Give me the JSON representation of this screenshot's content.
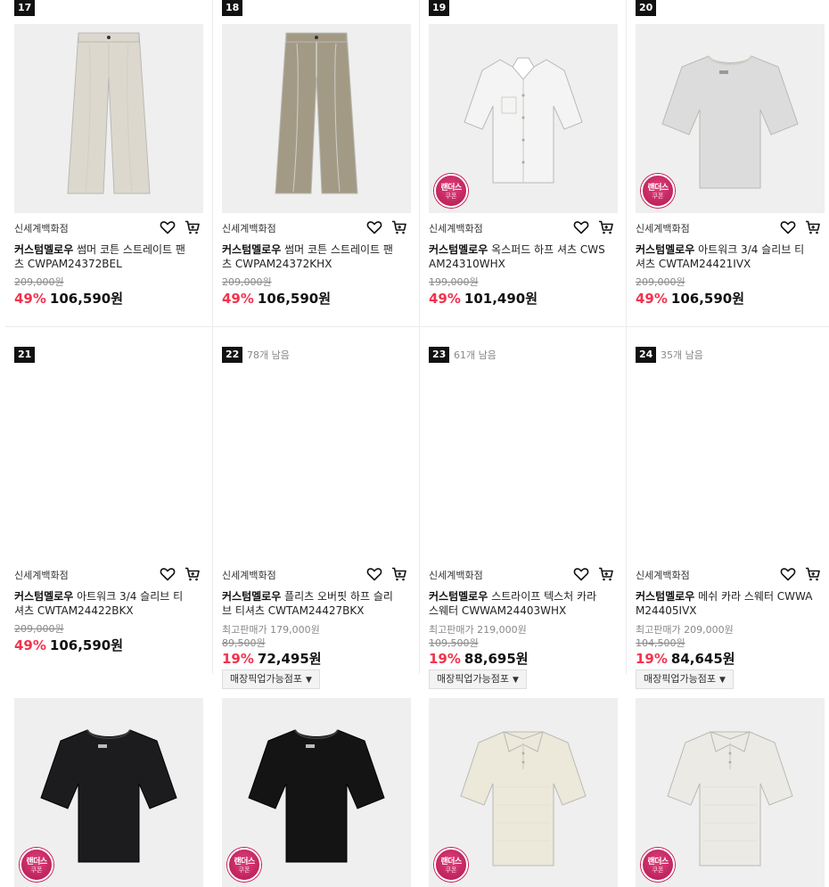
{
  "colors": {
    "discount": "#f2334d",
    "rank_bg": "#111111",
    "coupon": "#c9184f"
  },
  "products": [
    {
      "rank": "17",
      "stock": "",
      "store": "신세계백화점",
      "brand": "커스텀멜로우",
      "name": "썸머 코튼 스트레이트 팬츠 CWPAM24372BEL",
      "max_price": "",
      "original": "209,000원",
      "discount": "49%",
      "price": "106,590원",
      "pickup": "",
      "coupon": false,
      "icon": "pants-icon",
      "garment": "pants",
      "color": "#dcd8ce"
    },
    {
      "rank": "18",
      "stock": "",
      "store": "신세계백화점",
      "brand": "커스텀멜로우",
      "name": "썸머 코튼 스트레이트 팬츠 CWPAM24372KHX",
      "max_price": "",
      "original": "209,000원",
      "discount": "49%",
      "price": "106,590원",
      "pickup": "",
      "coupon": false,
      "icon": "pants-icon",
      "garment": "pants",
      "color": "#a39a85"
    },
    {
      "rank": "19",
      "stock": "",
      "store": "신세계백화점",
      "brand": "커스텀멜로우",
      "name": "옥스퍼드 하프 셔츠 CWSAM24310WHX",
      "max_price": "",
      "original": "199,000원",
      "discount": "49%",
      "price": "101,490원",
      "pickup": "",
      "coupon": true,
      "icon": "shirt-icon",
      "garment": "shirt",
      "color": "#f4f4f4"
    },
    {
      "rank": "20",
      "stock": "",
      "store": "신세계백화점",
      "brand": "커스텀멜로우",
      "name": "아트워크 3/4 슬리브 티셔츠 CWTAM24421IVX",
      "max_price": "",
      "original": "209,000원",
      "discount": "49%",
      "price": "106,590원",
      "pickup": "",
      "coupon": true,
      "icon": "tshirt-icon",
      "garment": "tee",
      "color": "#dcdcdc"
    },
    {
      "rank": "21",
      "stock": "",
      "store": "신세계백화점",
      "brand": "커스텀멜로우",
      "name": "아트워크 3/4 슬리브 티셔츠 CWTAM24422BKX",
      "max_price": "",
      "original": "209,000원",
      "discount": "49%",
      "price": "106,590원",
      "pickup": "",
      "coupon": true,
      "icon": "tshirt-icon",
      "garment": "tee",
      "color": "#1c1c1e"
    },
    {
      "rank": "22",
      "stock": "78개 남음",
      "store": "신세계백화점",
      "brand": "커스텀멜로우",
      "name": "플리츠 오버핏 하프 슬리브 티셔츠 CWTAM24427BKX",
      "max_price": "최고판매가 179,000원",
      "original": "89,500원",
      "discount": "19%",
      "price": "72,495원",
      "pickup": "매장픽업가능점포",
      "coupon": true,
      "icon": "tshirt-icon",
      "garment": "tee",
      "color": "#141414"
    },
    {
      "rank": "23",
      "stock": "61개 남음",
      "store": "신세계백화점",
      "brand": "커스텀멜로우",
      "name": "스트라이프 텍스처 카라 스웨터 CWWAM24403WHX",
      "max_price": "최고판매가 219,000원",
      "original": "109,500원",
      "discount": "19%",
      "price": "88,695원",
      "pickup": "매장픽업가능점포",
      "coupon": true,
      "icon": "polo-icon",
      "garment": "polo",
      "color": "#ece8da"
    },
    {
      "rank": "24",
      "stock": "35개 남음",
      "store": "신세계백화점",
      "brand": "커스텀멜로우",
      "name": "메쉬 카라 스웨터 CWWAM24405IVX",
      "max_price": "최고판매가 209,000원",
      "original": "104,500원",
      "discount": "19%",
      "price": "84,645원",
      "pickup": "매장픽업가능점포",
      "coupon": true,
      "icon": "polo-icon",
      "garment": "polo",
      "color": "#ebeae4"
    }
  ],
  "coupon_badge": {
    "line1": "랜더스",
    "line2": "쿠폰"
  },
  "icons": {
    "wishlist": "heart-icon",
    "cart": "cart-icon",
    "dropdown": "caret-down-icon"
  }
}
